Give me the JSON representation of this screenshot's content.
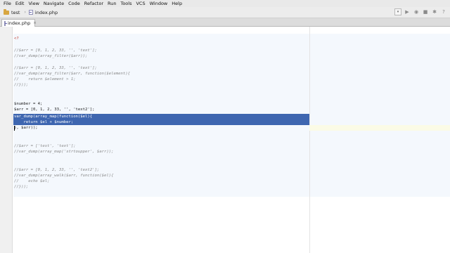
{
  "menu": [
    "File",
    "Edit",
    "View",
    "Navigate",
    "Code",
    "Refactor",
    "Run",
    "Tools",
    "VCS",
    "Window",
    "Help"
  ],
  "breadcrumbs": {
    "project": "test",
    "file": "index.php"
  },
  "tab": {
    "label": "index.php",
    "close": "×"
  },
  "code": {
    "line1": "<?",
    "line2": "//$arr = [0, 1, 2, 33, '', 'text'];",
    "line3": "//var_dump(array_filter($arr));",
    "line4": "//$arr = [0, 1, 2, 33, '', 'text'];",
    "line5": "//var_dump(array_filter($arr, function($element){",
    "line6": "//    return $element > 1;",
    "line7": "//}));",
    "line8": "$number = 4;",
    "line9": "$arr = [0, 1, 2, 33, '', 'text2'];",
    "line10": "var_dump(array_map(function($el){",
    "line11": "    return $el + $number;",
    "line12": "}, $arr));",
    "line13": "//$arr = ['test', 'text'];",
    "line14": "//var_dump(array_map('strtoupper', $arr));",
    "line15": "//$arr = [0, 1, 2, 33, '', 'text2'];",
    "line16": "//var_dump(array_walk($arr, function($el){",
    "line17": "//    echo $el;",
    "line18": "//}));"
  }
}
